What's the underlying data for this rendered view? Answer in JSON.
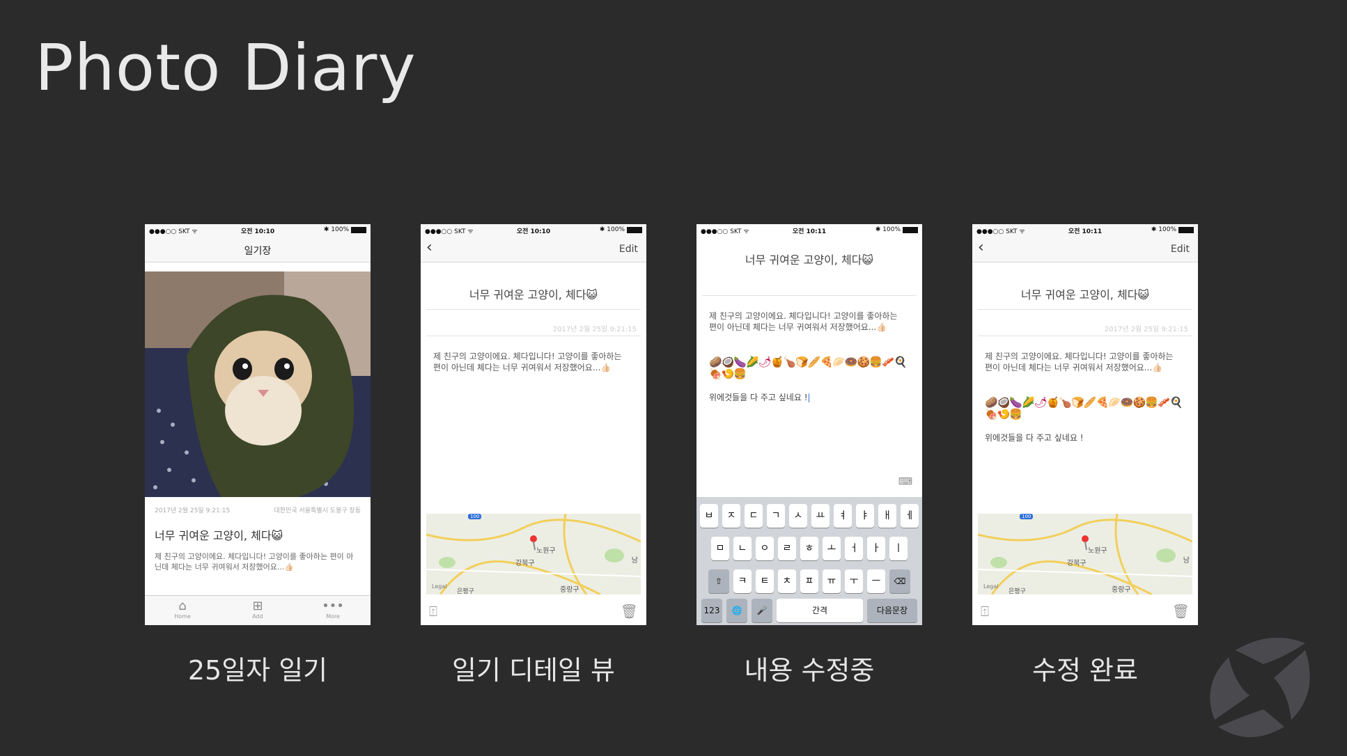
{
  "slide": {
    "title": "Photo Diary"
  },
  "screens": [
    {
      "status": {
        "carrier": "●●●○○ SKT ᯤ",
        "time": "오전 10:10",
        "battery": "✱ 100%"
      },
      "nav_title": "일기장",
      "date": "2017년 2월 25일 9:21:15",
      "location": "대한민국 서울특별시 도봉구 창동",
      "title": "너무 귀여운 고양이, 체다😺",
      "body": "제 친구의 고양이에요. 체다입니다! 고양이를 좋아하는 편이 아닌데 체다는 너무 귀여워서 저장했어요...👍🏻",
      "tabs": [
        {
          "icon": "⌂",
          "label": "Home"
        },
        {
          "icon": "⊞",
          "label": "Add"
        },
        {
          "icon": "•••",
          "label": "More"
        }
      ]
    },
    {
      "status": {
        "carrier": "●●●○○ SKT ᯤ",
        "time": "오전 10:10",
        "battery": "✱ 100%"
      },
      "back": "‹",
      "edit": "Edit",
      "title": "너무 귀여운 고양이, 체다😺",
      "date": "2017년 2월 25일 9:21:15",
      "body": "제 친구의 고양이에요. 체다입니다! 고양이를 좋아하는 편이 아닌데 체다는 너무 귀여워서 저장했어요...👍🏻"
    },
    {
      "status": {
        "carrier": "●●●○○ SKT ᯤ",
        "time": "오전 10:11",
        "battery": "✱ 100%"
      },
      "title": "너무 귀여운 고양이, 체다😺",
      "body": "제 친구의 고양이에요. 체다입니다! 고양이를 좋아하는 편이 아닌데 체다는 너무 귀여워서 저장했어요...👍🏻",
      "emojis": "🥔🥥🍆🌽🌶🍯🍗🍞🥖🍕🥟🍩🍪🍔🥓🍳🍖🍤🍔",
      "extra": "위에것들을 다 주고 싶네요 !",
      "keyboard": {
        "row1": [
          "ㅂ",
          "ㅈ",
          "ㄷ",
          "ㄱ",
          "ㅅ",
          "ㅛ",
          "ㅕ",
          "ㅑ",
          "ㅐ",
          "ㅔ"
        ],
        "row2": [
          "ㅁ",
          "ㄴ",
          "ㅇ",
          "ㄹ",
          "ㅎ",
          "ㅗ",
          "ㅓ",
          "ㅏ",
          "ㅣ"
        ],
        "row3": [
          "ㅋ",
          "ㅌ",
          "ㅊ",
          "ㅍ",
          "ㅠ",
          "ㅜ",
          "ㅡ"
        ],
        "shift": "⇧",
        "delete": "⌫",
        "num": "123",
        "globe": "🌐",
        "mic": "🎤",
        "space": "간격",
        "return": "다음문장"
      }
    },
    {
      "status": {
        "carrier": "●●●○○ SKT ᯤ",
        "time": "오전 10:11",
        "battery": "✱ 100%"
      },
      "back": "‹",
      "edit": "Edit",
      "title": "너무 귀여운 고양이, 체다😺",
      "date": "2017년 2월 25일 9:21:15",
      "body": "제 친구의 고양이에요. 체다입니다! 고양이를 좋아하는 편이 아닌데 체다는 너무 귀여워서 저장했어요...👍🏻",
      "emojis": "🥔🥥🍆🌽🌶🍯🍗🍞🥖🍕🥟🍩🍪🍔🥓🍳🍖🍤🍔",
      "extra": "위에것들을 다 주고 싶네요 !"
    }
  ],
  "map_labels": {
    "district1": "노원구",
    "district2": "강북구",
    "district3": "중랑구",
    "edge": "남",
    "legal": "Legal",
    "road": "은평구",
    "badge": "100"
  },
  "toolbar": {
    "share_icon": "⍐",
    "trash_icon": "🗑"
  },
  "captions": [
    "25일자 일기",
    "일기 디테일 뷰",
    "내용 수정중",
    "수정 완료"
  ]
}
